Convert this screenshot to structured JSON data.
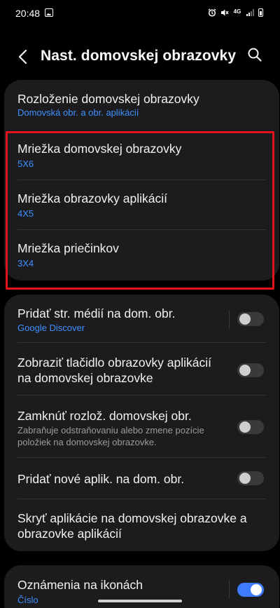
{
  "status": {
    "time": "20:48",
    "icons": [
      "image-icon",
      "alarm-icon",
      "mute-icon",
      "4g-icon",
      "signal-icon",
      "battery-icon"
    ],
    "network": "4G"
  },
  "header": {
    "title": "Nast. domovskej obrazovky",
    "back_icon": "back-arrow-icon",
    "search_icon": "search-icon"
  },
  "section1": {
    "items": [
      {
        "title": "Rozloženie domovskej obrazovky",
        "sub": "Domovská obr. a obr. aplikácií"
      },
      {
        "title": "Mriežka domovskej obrazovky",
        "sub": "5X6"
      },
      {
        "title": "Mriežka obrazovky aplikácií",
        "sub": "4X5"
      },
      {
        "title": "Mriežka priečinkov",
        "sub": "3X4"
      }
    ]
  },
  "section2": {
    "items": [
      {
        "title": "Pridať str. médií na dom. obr.",
        "sub": "Google Discover",
        "toggle": false
      },
      {
        "title_line1": "Zobraziť tlačidlo obrazovky aplikácií",
        "title_line2": "na domovskej obrazovke",
        "toggle": false
      },
      {
        "title": "Zamknúť rozlož. domovskej obr.",
        "desc_line1": "Zabraňuje odstraňovaniu alebo zmene pozície",
        "desc_line2": "položiek na domovskej obrazovke.",
        "toggle": false
      },
      {
        "title": "Pridať nové aplik. na dom. obr.",
        "toggle": false
      },
      {
        "title_line1": "Skryť aplikácie na domovskej obrazovke a",
        "title_line2": "obrazovke aplikácií"
      }
    ]
  },
  "section3": {
    "items": [
      {
        "title": "Oznámenia na ikonách",
        "sub": "Číslo",
        "toggle": true
      }
    ]
  },
  "colors": {
    "background": "#000000",
    "card": "#1c1c1e",
    "accent_blue": "#3e91ff",
    "toggle_on": "#3e7bff",
    "highlight_red": "#e3131b"
  }
}
